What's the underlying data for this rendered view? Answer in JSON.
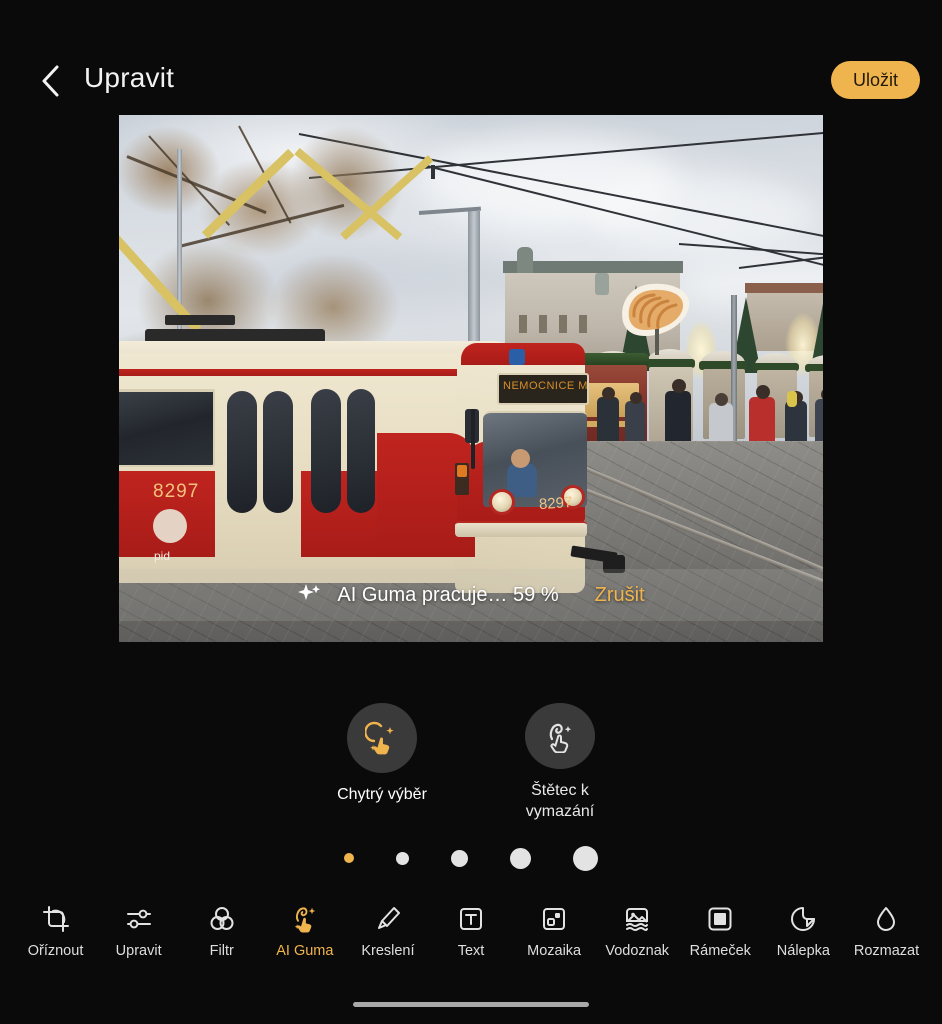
{
  "app": {
    "theme": "dark",
    "accent_color": "#f0b44e",
    "background_color": "#0a0a0a"
  },
  "header": {
    "back_icon": "chevron-left-icon",
    "title": "Upravit",
    "save_label": "Uložit"
  },
  "photo": {
    "description": "Vintage cream and red Tatra tram on cobblestone street with Christmas market stalls behind",
    "tram_number": "8297",
    "tram_operator_text": "pid",
    "destination_sign_text": "NEMOCNICE MOTOL",
    "alt": "tram-photo"
  },
  "progress": {
    "sparkle_icon": "sparkle-icon",
    "status_text": "AI Guma pracuje… 59 %",
    "percent": 59,
    "cancel_label": "Zrušit"
  },
  "subtools": [
    {
      "icon": "smart-select-icon",
      "label": "Chytrý výběr",
      "active": true
    },
    {
      "icon": "erase-brush-icon",
      "label": "Štětec k\nvymazání",
      "active": false
    }
  ],
  "subtool_labels": {
    "smart_select": "Chytrý výběr",
    "erase_brush_line1": "Štětec k",
    "erase_brush_line2": "vymazání"
  },
  "page_dots": [
    {
      "active": true,
      "size": 10
    },
    {
      "active": false,
      "size": 13
    },
    {
      "active": false,
      "size": 17
    },
    {
      "active": false,
      "size": 21
    },
    {
      "active": false,
      "size": 25
    }
  ],
  "bottom_toolbar": [
    {
      "icon": "crop-icon",
      "label": "Oříznout",
      "active": false
    },
    {
      "icon": "sliders-icon",
      "label": "Upravit",
      "active": false
    },
    {
      "icon": "filter-icon",
      "label": "Filtr",
      "active": false
    },
    {
      "icon": "ai-eraser-icon",
      "label": "AI Guma",
      "active": true
    },
    {
      "icon": "brush-icon",
      "label": "Kreslení",
      "active": false
    },
    {
      "icon": "text-icon",
      "label": "Text",
      "active": false
    },
    {
      "icon": "mosaic-icon",
      "label": "Mozaika",
      "active": false
    },
    {
      "icon": "watermark-icon",
      "label": "Vodoznak",
      "active": false
    },
    {
      "icon": "frame-icon",
      "label": "Rámeček",
      "active": false
    },
    {
      "icon": "sticker-icon",
      "label": "Nálepka",
      "active": false
    },
    {
      "icon": "blur-icon",
      "label": "Rozmazat",
      "active": false
    }
  ],
  "system": {
    "home_indicator": "home-indicator"
  }
}
